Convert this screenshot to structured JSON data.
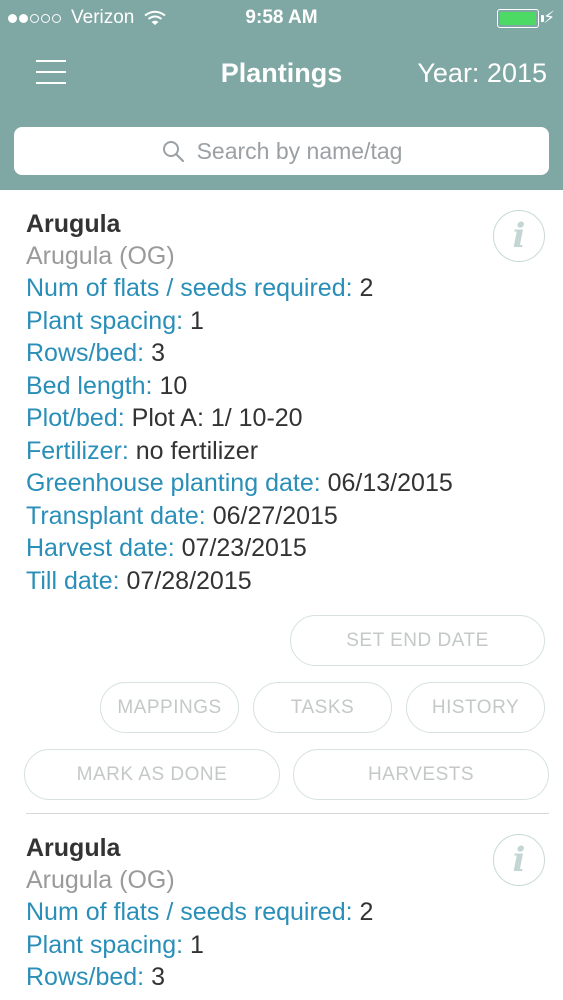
{
  "status_bar": {
    "carrier": "Verizon",
    "time": "9:58 AM",
    "signal_bars_filled": 2,
    "signal_bars_total": 5,
    "battery_color": "#4cd964"
  },
  "nav": {
    "title": "Plantings",
    "year": "Year: 2015",
    "menu_icon": "hamburger-icon"
  },
  "search": {
    "placeholder": "Search by name/tag",
    "icon": "search-icon"
  },
  "colors": {
    "header_bg": "#7fa7a3",
    "label": "#2a8fb8",
    "value": "#333333"
  },
  "cards": [
    {
      "title": "Arugula",
      "variety": "Arugula (OG)",
      "fields": [
        {
          "label": "Num of flats / seeds required:",
          "value": "2"
        },
        {
          "label": "Plant spacing:",
          "value": "1"
        },
        {
          "label": "Rows/bed:",
          "value": "3"
        },
        {
          "label": "Bed length:",
          "value": "10"
        },
        {
          "label": "Plot/bed:",
          "value": "Plot A: 1/ 10-20"
        },
        {
          "label": "Fertilizer:",
          "value": "no fertilizer"
        },
        {
          "label": "Greenhouse planting date:",
          "value": "06/13/2015"
        },
        {
          "label": "Transplant date:",
          "value": "06/27/2015"
        },
        {
          "label": "Harvest date:",
          "value": "07/23/2015"
        },
        {
          "label": "Till date:",
          "value": "07/28/2015"
        }
      ],
      "buttons": {
        "set_end_date": "SET END DATE",
        "mappings": "MAPPINGS",
        "tasks": "TASKS",
        "history": "HISTORY",
        "mark_as_done": "MARK AS DONE",
        "harvests": "HARVESTS"
      }
    },
    {
      "title": "Arugula",
      "variety": "Arugula (OG)",
      "fields": [
        {
          "label": "Num of flats / seeds required:",
          "value": "2"
        },
        {
          "label": "Plant spacing:",
          "value": "1"
        },
        {
          "label": "Rows/bed:",
          "value": "3"
        }
      ]
    }
  ]
}
